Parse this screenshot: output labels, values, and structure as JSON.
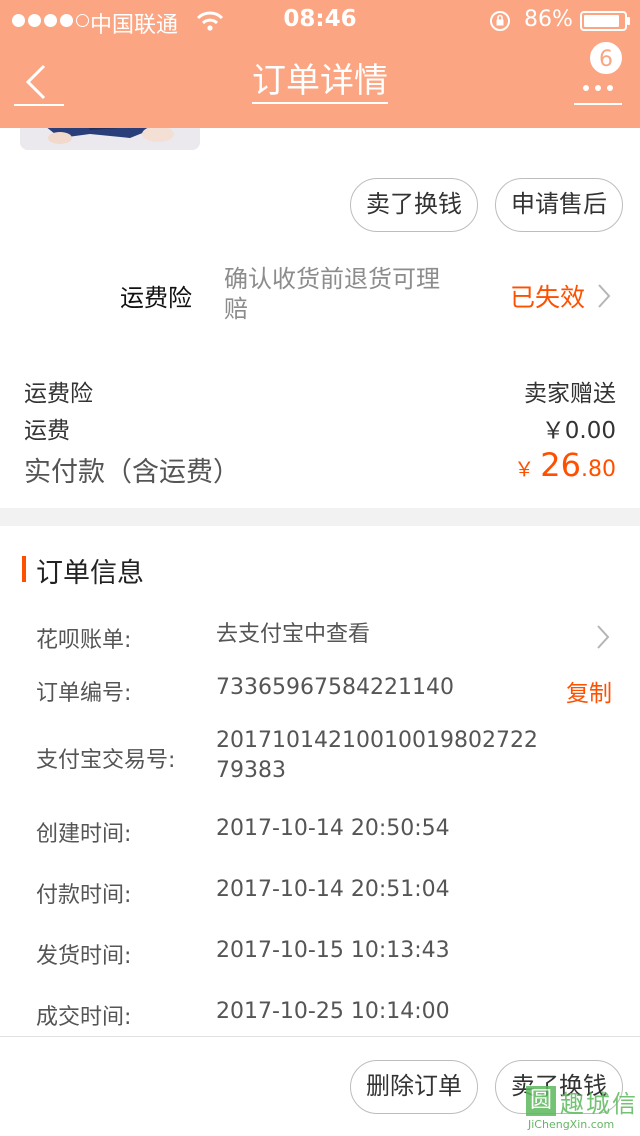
{
  "status_bar": {
    "carrier": "中国联通",
    "time": "08:46",
    "battery": "86%"
  },
  "nav": {
    "title": "订单详情",
    "badge": "6",
    "back_icon": "chevron-left-icon",
    "more_icon": "more-dots-icon"
  },
  "top_actions": {
    "sell_label": "卖了换钱",
    "after_sale_label": "申请售后"
  },
  "insurance": {
    "label": "运费险",
    "description": "确认收货前退货可理赔",
    "status": "已失效"
  },
  "summary": {
    "rows": [
      {
        "label": "运费险",
        "value": "卖家赠送"
      },
      {
        "label": "运费",
        "value": "￥0.00"
      }
    ],
    "paid_label": "实付款（含运费）",
    "paid_currency": "￥",
    "paid_int": "26",
    "paid_dec": ".80"
  },
  "order_info": {
    "title": "订单信息",
    "rows": [
      {
        "label": "花呗账单:",
        "value": "去支付宝中查看"
      },
      {
        "label": "订单编号:",
        "value": "73365967584221140"
      },
      {
        "label": "支付宝交易号:",
        "value": "2017101421001001980272279383"
      },
      {
        "label": "创建时间:",
        "value": "2017-10-14 20:50:54"
      },
      {
        "label": "付款时间:",
        "value": "2017-10-14 20:51:04"
      },
      {
        "label": "发货时间:",
        "value": "2017-10-15 10:13:43"
      },
      {
        "label": "成交时间:",
        "value": "2017-10-25 10:14:00"
      }
    ],
    "copy_label": "复制"
  },
  "bottom_bar": {
    "delete_label": "删除订单",
    "sell_label": "卖了换钱"
  },
  "watermark": {
    "glyph": "圆",
    "name": "趣城信",
    "domain": "JiChengXin.com"
  },
  "colors": {
    "header": "#fba582",
    "accent": "#ff5000"
  }
}
